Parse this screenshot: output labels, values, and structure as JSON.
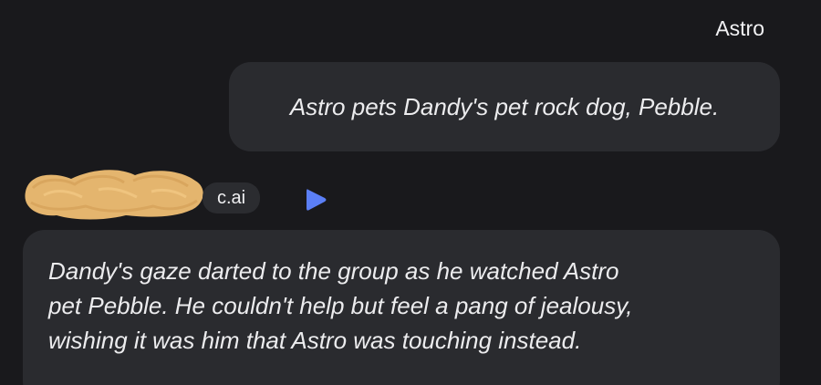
{
  "user_message": {
    "sender": "Astro",
    "text": "Astro pets Dandy's pet rock dog, Pebble."
  },
  "bot_message": {
    "badge": "c.ai",
    "voice_icon": "play-triangle-icon",
    "name_redacted": true,
    "text_lines": [
      "Dandy's gaze darted to the group as he watched Astro",
      "pet Pebble. He couldn't help but feel a pang of jealousy,",
      "wishing it was him that Astro was touching instead."
    ]
  },
  "colors": {
    "background": "#19191c",
    "bubble": "#2a2b2f",
    "text": "#ececee",
    "redaction": "#e4b56e",
    "play_accent": "#5b7ff6"
  }
}
